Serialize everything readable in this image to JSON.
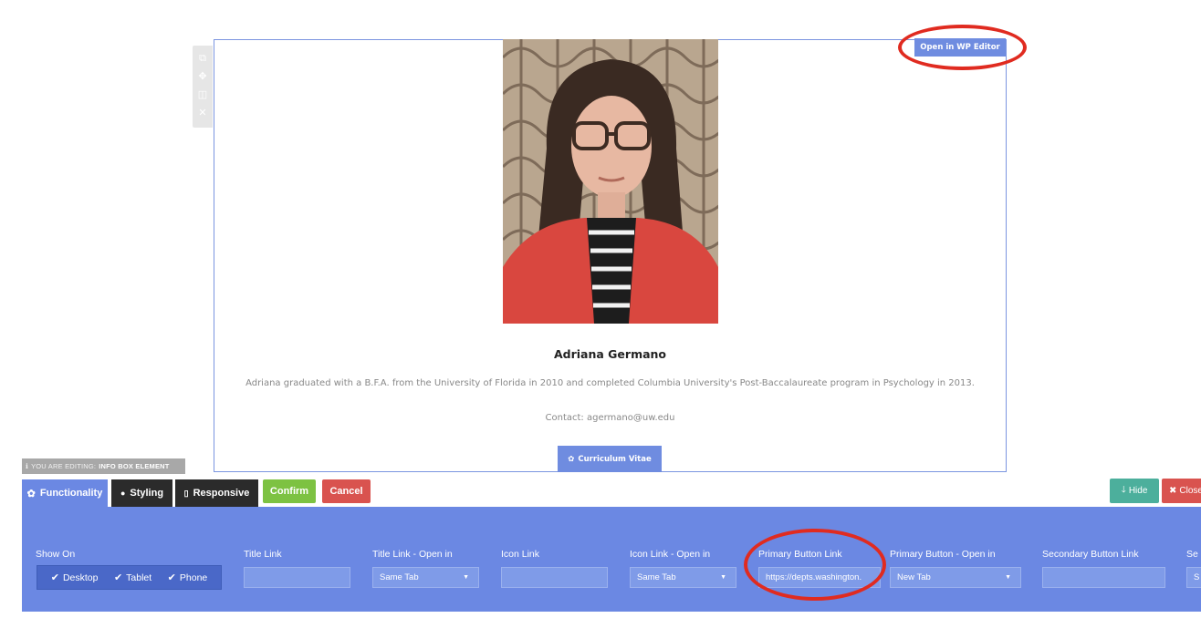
{
  "element_toolbar": {
    "icons": [
      "copy-icon",
      "move-icon",
      "columns-icon",
      "close-icon"
    ]
  },
  "info_box": {
    "name": "Adriana Germano",
    "description": "Adriana graduated with a B.F.A. from the University of Florida in 2010 and completed Columbia University's Post-Baccalaureate program in Psychology in 2013.",
    "contact": "Contact: agermano@uw.edu",
    "primary_button_label": "Curriculum Vitae",
    "wp_editor_button_label": "Open in WP Editor"
  },
  "editing_label": {
    "prefix": "YOU ARE EDITING:",
    "element": "INFO BOX ELEMENT"
  },
  "tabs": [
    {
      "label": "Functionality",
      "icon": "gear-icon",
      "active": true
    },
    {
      "label": "Styling",
      "icon": "drop-icon",
      "active": false
    },
    {
      "label": "Responsive",
      "icon": "mobile-icon",
      "active": false
    }
  ],
  "actions": {
    "confirm": "Confirm",
    "cancel": "Cancel",
    "hide": "Hide",
    "close": "Close"
  },
  "panel": {
    "show_on": {
      "label": "Show On",
      "options": [
        "Desktop",
        "Tablet",
        "Phone"
      ]
    },
    "title_link": {
      "label": "Title Link",
      "value": ""
    },
    "title_link_open": {
      "label": "Title Link - Open in",
      "value": "Same Tab"
    },
    "icon_link": {
      "label": "Icon Link",
      "value": ""
    },
    "icon_link_open": {
      "label": "Icon Link - Open in",
      "value": "Same Tab"
    },
    "primary_button_link": {
      "label": "Primary Button Link",
      "value": "https://depts.washington."
    },
    "primary_button_open": {
      "label": "Primary Button - Open in",
      "value": "New Tab"
    },
    "secondary_button_link": {
      "label": "Secondary Button Link",
      "value": ""
    },
    "secondary_button_open": {
      "label": "Se",
      "value": "S"
    }
  },
  "colors": {
    "accent_blue": "#6b88e3",
    "confirm_green": "#7dc242",
    "cancel_red": "#d9534f",
    "annotation_red": "#e02b20"
  }
}
